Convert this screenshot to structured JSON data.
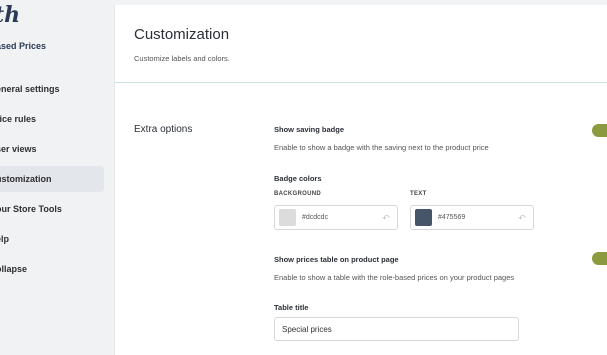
{
  "sidebar": {
    "logo": "th",
    "plugin_name": "ased Prices",
    "items": [
      {
        "label": "eneral settings"
      },
      {
        "label": "rice rules"
      },
      {
        "label": "ser views"
      },
      {
        "label": "ustomization"
      },
      {
        "label": "our Store Tools"
      },
      {
        "label": "elp"
      },
      {
        "label": "ollapse"
      }
    ]
  },
  "header": {
    "title": "Customization",
    "subtitle": "Customize labels and colors."
  },
  "section": {
    "label": "Extra options"
  },
  "saving_badge": {
    "label": "Show saving badge",
    "description": "Enable to show a badge with the saving next to the product price",
    "enabled": true
  },
  "badge_colors": {
    "label": "Badge colors",
    "background_label": "BACKGROUND",
    "background_value": "#dcdcdc",
    "text_label": "TEXT",
    "text_value": "#475569"
  },
  "prices_table": {
    "label": "Show prices table on product page",
    "description": "Enable to show a table with the role-based prices on your product pages",
    "enabled": true
  },
  "table_title": {
    "label": "Table title",
    "value": "Special prices"
  },
  "colors": {
    "toggle_on": "#8a9a3c",
    "sidebar_active": "#e3e6ea"
  }
}
